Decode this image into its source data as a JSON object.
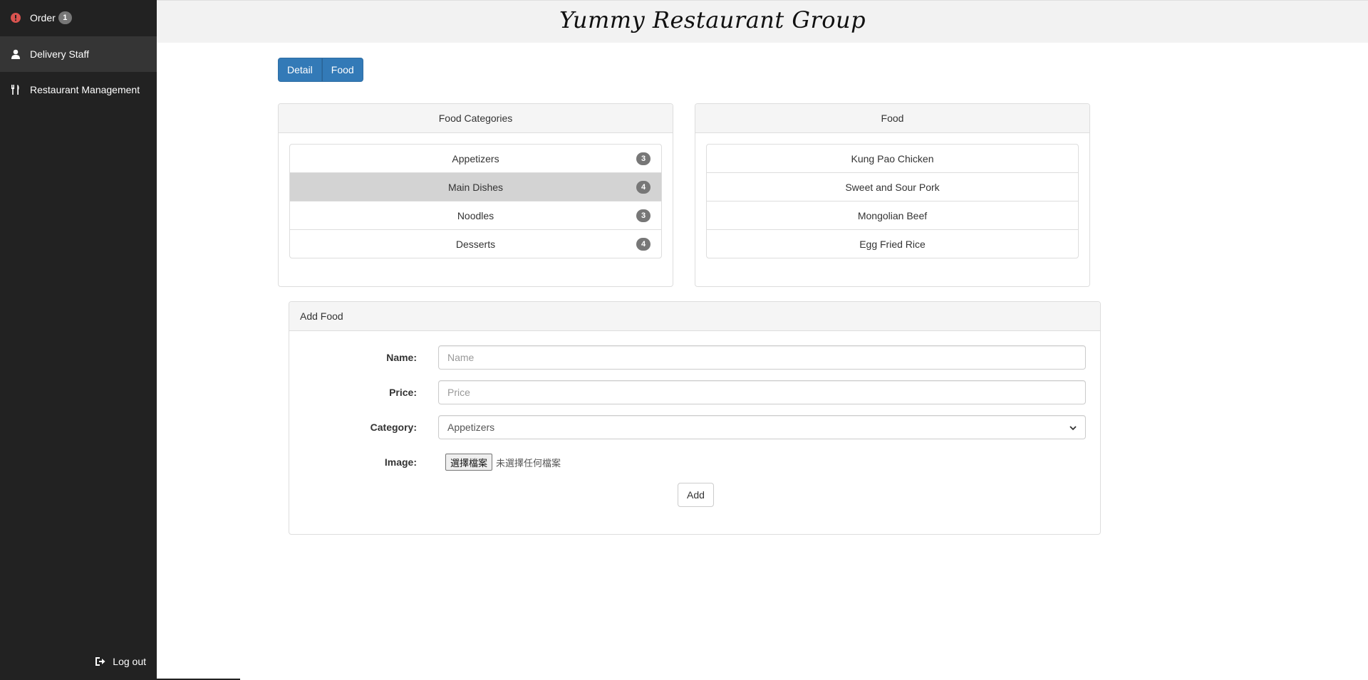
{
  "sidebar": {
    "items": [
      {
        "label": "Order",
        "badge": "1",
        "icon": "alert-circle-icon"
      },
      {
        "label": "Delivery Staff",
        "icon": "user-icon"
      },
      {
        "label": "Restaurant Management",
        "icon": "cutlery-icon"
      }
    ],
    "logout_label": "Log out",
    "logout_icon": "logout-icon"
  },
  "header": {
    "brand": "Yummy Restaurant Group"
  },
  "tabs": {
    "detail": "Detail",
    "food": "Food"
  },
  "categories_panel": {
    "title": "Food Categories",
    "items": [
      {
        "label": "Appetizers",
        "count": "3"
      },
      {
        "label": "Main Dishes",
        "count": "4",
        "active": true
      },
      {
        "label": "Noodles",
        "count": "3"
      },
      {
        "label": "Desserts",
        "count": "4"
      }
    ]
  },
  "food_panel": {
    "title": "Food",
    "items": [
      {
        "label": "Kung Pao Chicken"
      },
      {
        "label": "Sweet and Sour Pork"
      },
      {
        "label": "Mongolian Beef"
      },
      {
        "label": "Egg Fried Rice"
      }
    ]
  },
  "add_food": {
    "title": "Add Food",
    "name_label": "Name:",
    "name_placeholder": "Name",
    "price_label": "Price:",
    "price_placeholder": "Price",
    "category_label": "Category:",
    "category_value": "Appetizers",
    "image_label": "Image:",
    "file_button": "選擇檔案",
    "file_status": "未選擇任何檔案",
    "add_button": "Add"
  },
  "colors": {
    "sidebar_bg": "#222222",
    "primary": "#337ab7",
    "badge": "#777777",
    "alert_icon": "#d9534f"
  }
}
